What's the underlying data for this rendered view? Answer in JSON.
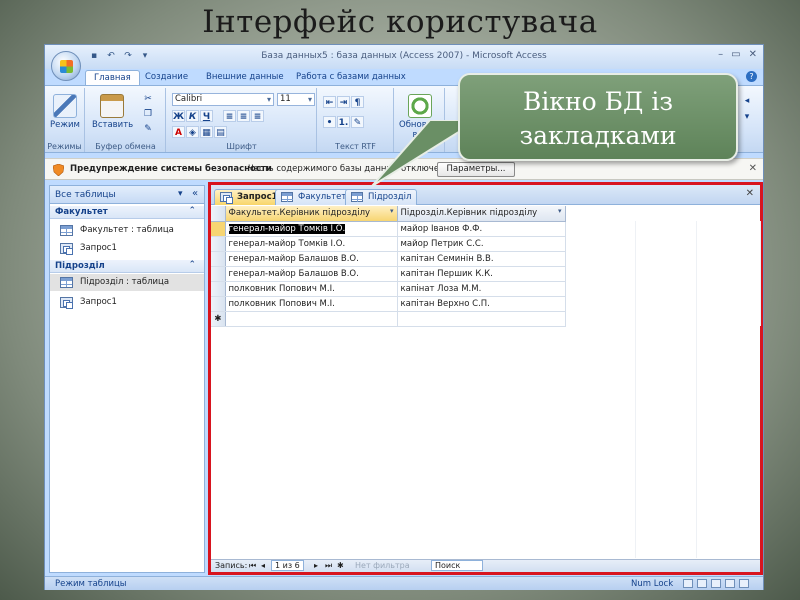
{
  "slide": {
    "title": "Інтерфейс користувача"
  },
  "window": {
    "title": "База данных5 : база данных (Access 2007) - Microsoft Access"
  },
  "ribbon_tabs": [
    "Главная",
    "Создание",
    "Внешние данные",
    "Работа с базами данных"
  ],
  "ribbon": {
    "view_label": "Режим",
    "paste_label": "Вставить",
    "refresh_label": "Обновить все",
    "font_name": "Calibri",
    "font_size": "11",
    "groups": [
      "Режимы",
      "Буфер обмена",
      "Шрифт",
      "Текст RTF"
    ]
  },
  "security_bar": {
    "warning": "Предупреждение системы безопасности",
    "message": "Часть содержимого базы данных отключено",
    "button": "Параметры..."
  },
  "nav": {
    "header": "Все таблицы",
    "groups": [
      {
        "name": "Факультет",
        "items": [
          "Факультет : таблица",
          "Запрос1"
        ]
      },
      {
        "name": "Підрозділ",
        "items": [
          "Підрозділ : таблица",
          "Запрос1"
        ]
      }
    ]
  },
  "doc_tabs": [
    "Запрос1",
    "Факультет",
    "Підрозділ"
  ],
  "grid": {
    "columns": [
      "Факультет.Керівник підрозділу",
      "Підрозділ.Керівник підрозділу"
    ],
    "rows": [
      [
        "генерал-майор Томків І.О.",
        "майор Іванов Ф.Ф."
      ],
      [
        "генерал-майор Томків І.О.",
        "майор Петрик С.С."
      ],
      [
        "генерал-майор Балашов В.О.",
        "капітан Семинін В.В."
      ],
      [
        "генерал-майор Балашов В.О.",
        "капітан Першик К.К."
      ],
      [
        "полковник Попович М.І.",
        "капінат Лоза М.М."
      ],
      [
        "полковник Попович М.І.",
        "капітан Верхно С.П."
      ]
    ],
    "new_row_marker": "✱"
  },
  "record_nav": {
    "label": "Запись:",
    "position": "1 из 6",
    "filter": "Нет фильтра",
    "search": "Поиск"
  },
  "statusbar": {
    "left": "Режим таблицы",
    "right": "Num Lock"
  },
  "callout": {
    "line1": "Вікно БД із",
    "line2": "закладками"
  },
  "colors": {
    "highlight_border": "#d8141f",
    "callout_fill": "#6f936a"
  }
}
